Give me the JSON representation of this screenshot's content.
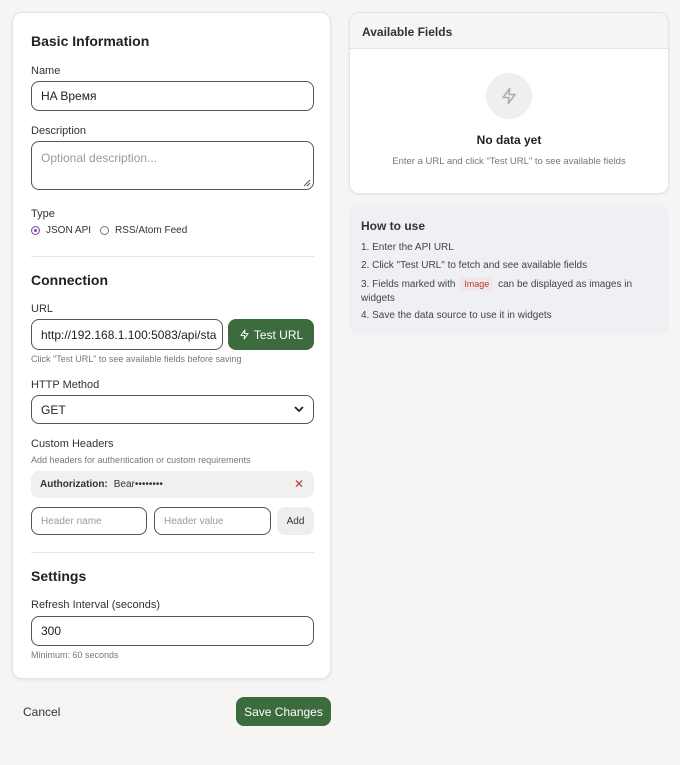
{
  "basic": {
    "title": "Basic Information",
    "name_label": "Name",
    "name_value": "HA Время",
    "description_label": "Description",
    "description_placeholder": "Optional description...",
    "type_label": "Type",
    "type_options": [
      "JSON API",
      "RSS/Atom Feed"
    ],
    "type_selected": "JSON API"
  },
  "connection": {
    "title": "Connection",
    "url_label": "URL",
    "url_value": "http://192.168.1.100:5083/api/sta",
    "test_button": "Test URL",
    "url_hint": "Click \"Test URL\" to see available fields before saving",
    "method_label": "HTTP Method",
    "method_value": "GET",
    "headers_label": "Custom Headers",
    "headers_hint": "Add headers for authentication or custom requirements",
    "header_items": [
      {
        "key": "Authorization:",
        "value": "Bear••••••••"
      }
    ],
    "header_name_placeholder": "Header name",
    "header_value_placeholder": "Header value",
    "add_button": "Add"
  },
  "settings": {
    "title": "Settings",
    "refresh_label": "Refresh Interval (seconds)",
    "refresh_value": "300",
    "refresh_hint": "Minimum: 60 seconds"
  },
  "footer": {
    "cancel": "Cancel",
    "save": "Save Changes"
  },
  "available_fields": {
    "title": "Available Fields",
    "empty_title": "No data yet",
    "empty_hint": "Enter a URL and click \"Test URL\" to see available fields"
  },
  "how_to": {
    "title": "How to use",
    "step1": "1. Enter the API URL",
    "step2": "2. Click \"Test URL\" to fetch and see available fields",
    "step3_pre": "3. Fields marked with",
    "step3_tag": "Image",
    "step3_post": "can be displayed as images in widgets",
    "step4": "4. Save the data source to use it in widgets"
  },
  "colors": {
    "accent": "#3c6b3e",
    "radio": "#8a48b6",
    "image_tag": "#b23a3a"
  }
}
